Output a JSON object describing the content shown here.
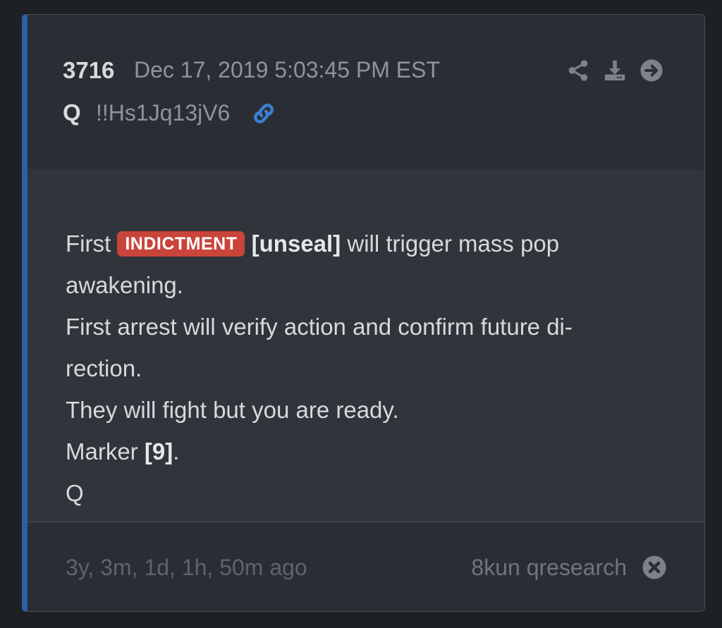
{
  "post": {
    "number": "3716",
    "date": "Dec 17, 2019 5:03:45 PM EST",
    "author": "Q",
    "tripcode": "!!Hs1Jq13jV6"
  },
  "actions": {
    "share_icon": "share-icon",
    "download_icon": "download-icon",
    "next_icon": "arrow-right-icon",
    "link_icon": "link-icon"
  },
  "body": {
    "line1_pre": "First",
    "badge": "INDICTMENT",
    "line1_bold": "[unseal]",
    "line1_post": "will trigger mass pop",
    "line2": "awakening.",
    "line3": "First arrest will verify action and confirm future di-",
    "line4": "rection.",
    "line5": "They will fight but you are ready.",
    "line6_pre": "Marker",
    "line6_bold": "[9]",
    "line6_post": ".",
    "line7": "Q"
  },
  "footer": {
    "ago": "3y, 3m, 1d, 1h, 50m ago",
    "source": "8kun qresearch"
  },
  "colors": {
    "accent": "#2b5fa8",
    "badge": "#c9443a",
    "link": "#3b7fd4"
  }
}
